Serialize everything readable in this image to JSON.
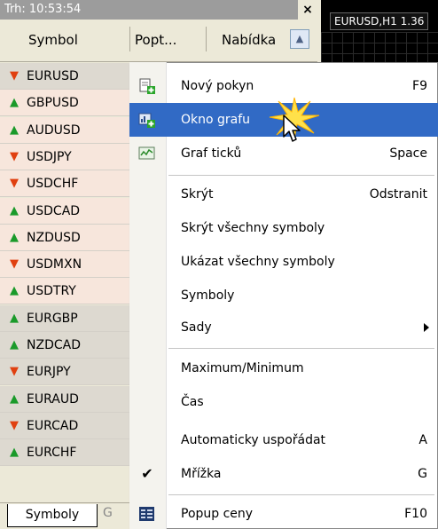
{
  "market_watch": {
    "title": "Trh: 10:53:54",
    "close_glyph": "×",
    "columns": [
      "Symbol",
      "Popt...",
      "Nabídka"
    ],
    "symbols": [
      {
        "name": "EURUSD",
        "dir": "down",
        "bg": "#ddd9d0"
      },
      {
        "name": "GBPUSD",
        "dir": "up",
        "bg": "#f7e6dc"
      },
      {
        "name": "AUDUSD",
        "dir": "up",
        "bg": "#f7e6dc"
      },
      {
        "name": "USDJPY",
        "dir": "down",
        "bg": "#f7e6dc"
      },
      {
        "name": "USDCHF",
        "dir": "down",
        "bg": "#f7e6dc"
      },
      {
        "name": "USDCAD",
        "dir": "up",
        "bg": "#f7e6dc"
      },
      {
        "name": "NZDUSD",
        "dir": "up",
        "bg": "#f7e6dc"
      },
      {
        "name": "USDMXN",
        "dir": "down",
        "bg": "#f7e6dc"
      },
      {
        "name": "USDTRY",
        "dir": "up",
        "bg": "#f7e6dc"
      },
      {
        "name": "EURGBP",
        "dir": "up",
        "bg": "#ddd9d0"
      },
      {
        "name": "NZDCAD",
        "dir": "up",
        "bg": "#ddd9d0"
      },
      {
        "name": "EURJPY",
        "dir": "down",
        "bg": "#ddd9d0"
      },
      {
        "name": "EURAUD",
        "dir": "up",
        "bg": "#ddd9d0"
      },
      {
        "name": "EURCAD",
        "dir": "down",
        "bg": "#ddd9d0"
      },
      {
        "name": "EURCHF",
        "dir": "up",
        "bg": "#ddd9d0"
      }
    ],
    "tabs": {
      "active": "Symboly",
      "other": "G"
    }
  },
  "chart_tab": {
    "label": "EURUSD,H1 1.36"
  },
  "context_menu": {
    "new_order": {
      "label": "Nový pokyn",
      "shortcut": "F9"
    },
    "chart_window": {
      "label": "Okno grafu"
    },
    "tick_chart": {
      "label": "Graf ticků",
      "shortcut": "Space"
    },
    "hide": {
      "label": "Skrýt",
      "shortcut": "Odstranit"
    },
    "hide_all": {
      "label": "Skrýt všechny symboly"
    },
    "show_all": {
      "label": "Ukázat všechny symboly"
    },
    "symbols": {
      "label": "Symboly"
    },
    "sets": {
      "label": "Sady"
    },
    "high_low": {
      "label": "Maximum/Minimum"
    },
    "time": {
      "label": "Čas"
    },
    "auto_arrange": {
      "label": "Automaticky uspořádat",
      "shortcut": "A"
    },
    "grid": {
      "label": "Mřížka",
      "shortcut": "G",
      "check": "✔"
    },
    "popup_prices": {
      "label": "Popup ceny",
      "shortcut": "F10"
    }
  },
  "colors": {
    "highlight": "#316ac5",
    "up_arrow": "#1a9a2a",
    "down_arrow": "#e04010"
  }
}
